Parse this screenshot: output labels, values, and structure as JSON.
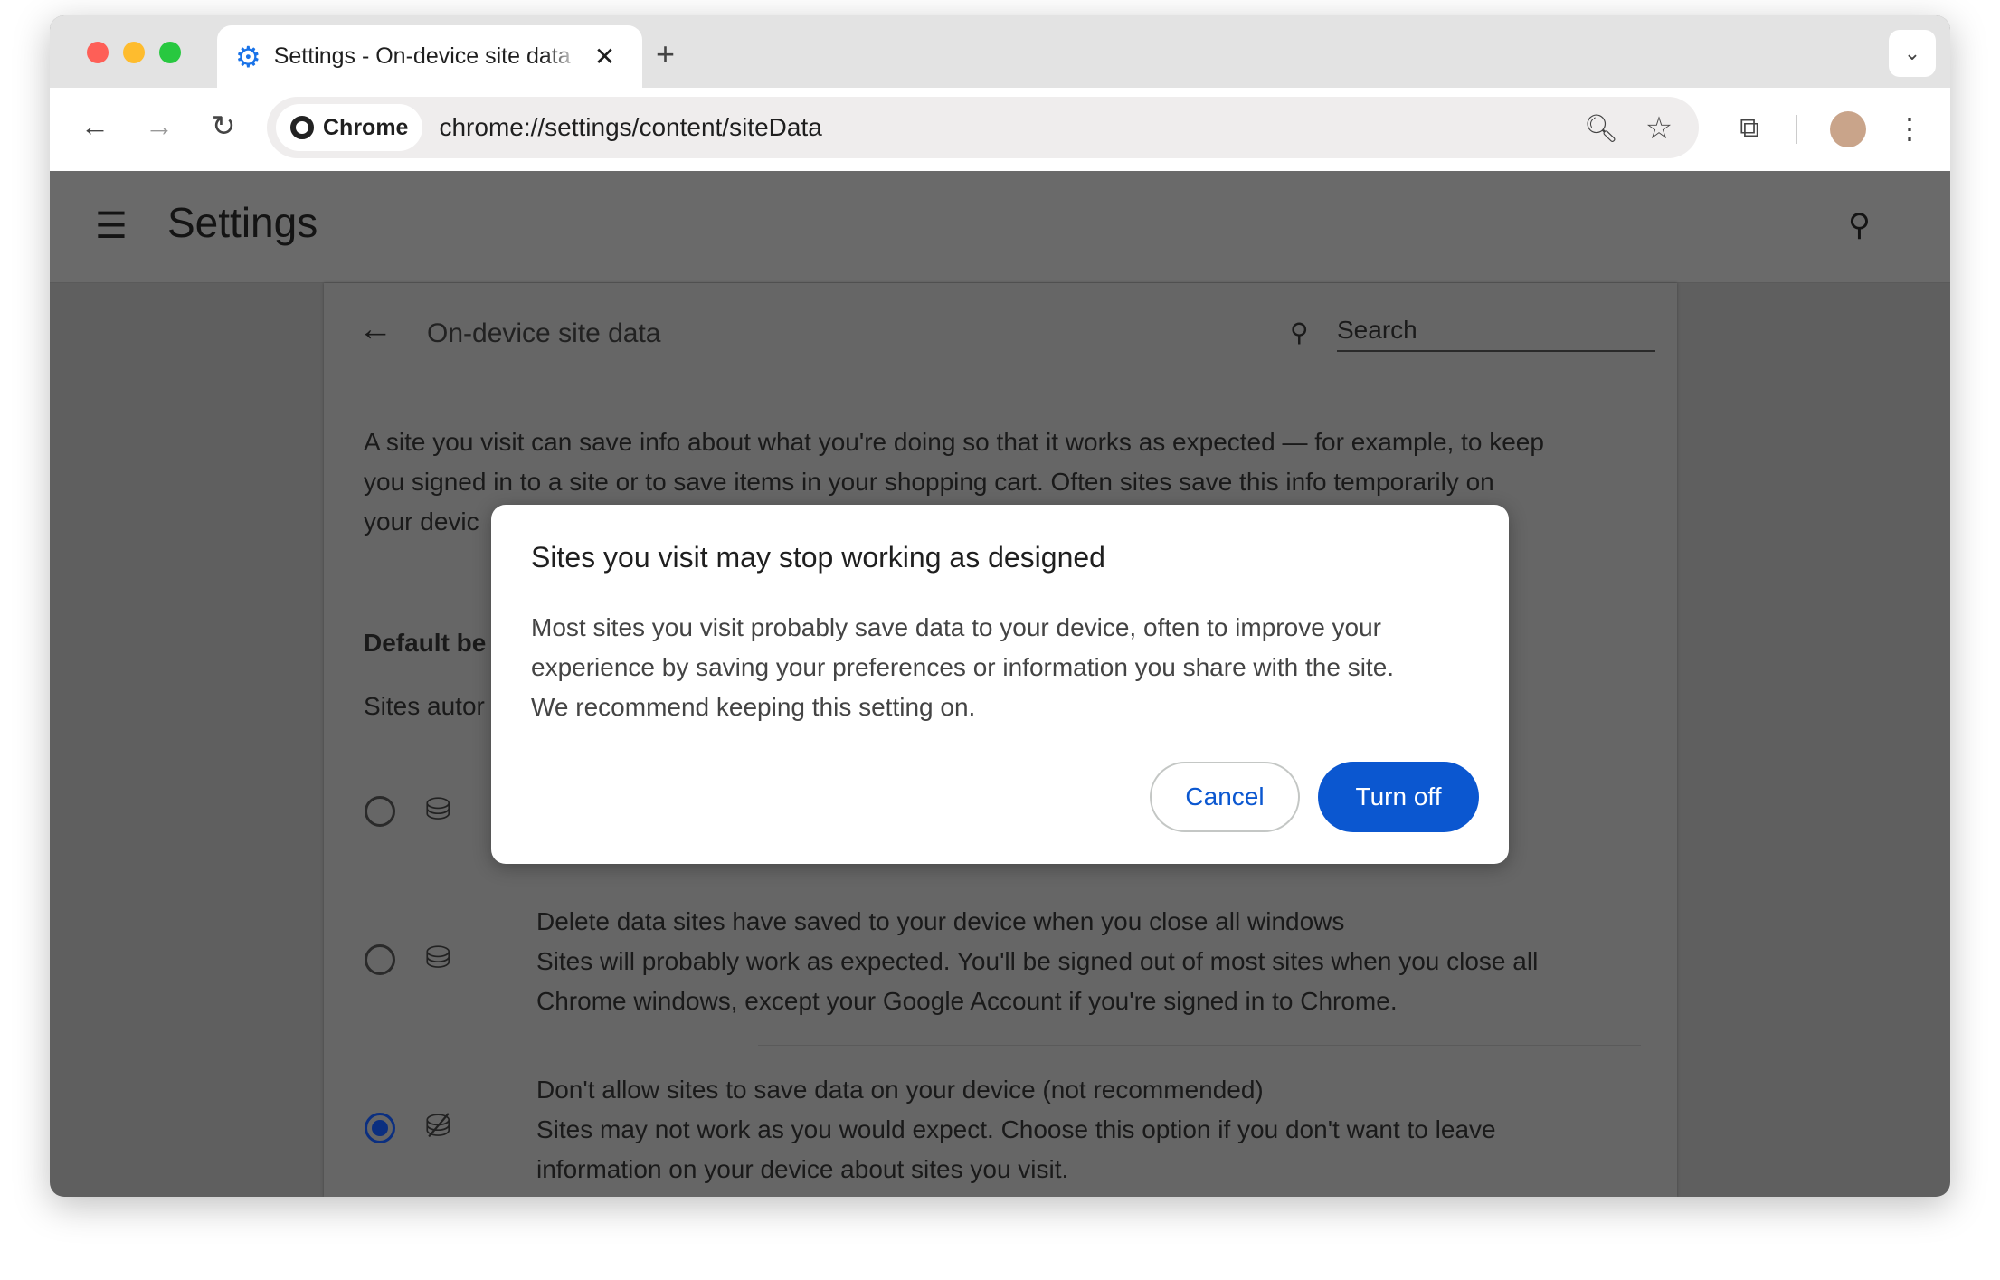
{
  "browser": {
    "tab_title": "Settings - On-device site data",
    "chip_label": "Chrome",
    "url": "chrome://settings/content/siteData"
  },
  "settings": {
    "title": "Settings"
  },
  "page": {
    "title": "On-device site data",
    "search_placeholder": "Search",
    "intro_lines": [
      "A site you visit can save info about what you're doing so that it works as expected — for example, to keep",
      "you signed in to a site or to save items in your shopping cart. Often sites save this info temporarily on",
      "your devic"
    ],
    "default_heading": "Default be",
    "sites_line": "Sites autor",
    "options": [
      {
        "title": "",
        "desc": "",
        "selected": false
      },
      {
        "title": "Delete data sites have saved to your device when you close all windows",
        "desc1": "Sites will probably work as expected. You'll be signed out of most sites when you close all",
        "desc2": "Chrome windows, except your Google Account if you're signed in to Chrome.",
        "selected": false
      },
      {
        "title": "Don't allow sites to save data on your device (not recommended)",
        "desc1": "Sites may not work as you would expect. Choose this option if you don't want to leave",
        "desc2": "information on your device about sites you visit.",
        "selected": true
      }
    ]
  },
  "dialog": {
    "title": "Sites you visit may stop working as designed",
    "body": [
      "Most sites you visit probably save data to your device, often to improve your",
      "experience by saving your preferences or information you share with the site.",
      "We recommend keeping this setting on."
    ],
    "cancel": "Cancel",
    "confirm": "Turn off"
  },
  "colors": {
    "accent": "#0b57d0"
  }
}
